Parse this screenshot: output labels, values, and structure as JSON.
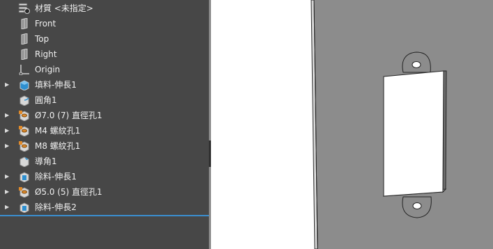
{
  "tree": {
    "items": [
      {
        "label": "材質 <未指定>",
        "icon": "material-icon",
        "expandable": false
      },
      {
        "label": "Front",
        "icon": "plane-icon",
        "expandable": false
      },
      {
        "label": "Top",
        "icon": "plane-icon",
        "expandable": false
      },
      {
        "label": "Right",
        "icon": "plane-icon",
        "expandable": false
      },
      {
        "label": "Origin",
        "icon": "origin-icon",
        "expandable": false
      },
      {
        "label": "填料-伸長1",
        "icon": "boss-extrude-icon",
        "expandable": true
      },
      {
        "label": "圓角1",
        "icon": "fillet-icon",
        "expandable": false
      },
      {
        "label": "Ø7.0 (7) 直徑孔1",
        "icon": "hole-wizard-icon",
        "expandable": true
      },
      {
        "label": "M4 螺紋孔1",
        "icon": "hole-wizard-icon",
        "expandable": true
      },
      {
        "label": "M8 螺紋孔1",
        "icon": "hole-wizard-icon",
        "expandable": true
      },
      {
        "label": "導角1",
        "icon": "chamfer-icon",
        "expandable": false
      },
      {
        "label": "除料-伸長1",
        "icon": "cut-extrude-icon",
        "expandable": true
      },
      {
        "label": "Ø5.0 (5) 直徑孔1",
        "icon": "hole-wizard-icon",
        "expandable": true
      },
      {
        "label": "除料-伸長2",
        "icon": "cut-extrude-icon",
        "expandable": true
      }
    ]
  },
  "viewport": {
    "panel_color": "#8c8c8c",
    "model": "panel-with-rectangular-cutout-and-tabs"
  },
  "colors": {
    "tree_bg": "#474747",
    "accent": "#3a8fd0",
    "text": "#f0f0f0"
  }
}
